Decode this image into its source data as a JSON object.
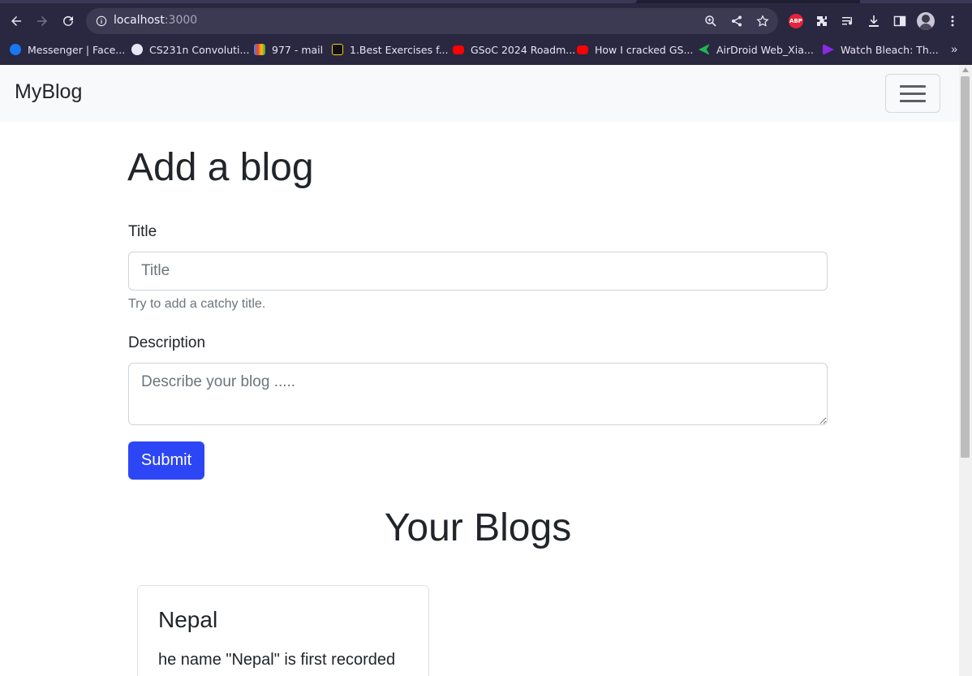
{
  "browser": {
    "url_host": "localhost",
    "url_port": ":3000",
    "bookmarks": [
      {
        "label": "Messenger | Face...",
        "icon": "facebook-icon",
        "color": "#1877f2"
      },
      {
        "label": "CS231n Convoluti...",
        "icon": "globe-icon",
        "color": "#e8e6f2"
      },
      {
        "label": "977 - mail",
        "icon": "gmail-icon",
        "color": "#ea4335"
      },
      {
        "label": "1.Best Exercises f...",
        "icon": "s-icon",
        "color": "#f5d000"
      },
      {
        "label": "GSoC 2024 Roadm...",
        "icon": "youtube-icon",
        "color": "#ff0000"
      },
      {
        "label": "How I cracked GS...",
        "icon": "youtube-icon",
        "color": "#ff0000"
      },
      {
        "label": "AirDroid Web_Xia...",
        "icon": "airdroid-icon",
        "color": "#1db954"
      },
      {
        "label": "Watch Bleach: Th...",
        "icon": "play-icon",
        "color": "#8a2be2"
      }
    ],
    "more": "»"
  },
  "navbar": {
    "brand": "MyBlog"
  },
  "form": {
    "heading": "Add a blog",
    "title_label": "Title",
    "title_placeholder": "Title",
    "title_value": "",
    "title_help": "Try to add a catchy title.",
    "description_label": "Description",
    "description_placeholder": "Describe your blog .....",
    "description_value": "",
    "submit_label": "Submit"
  },
  "blogs": {
    "heading": "Your Blogs",
    "items": [
      {
        "title": "Nepal",
        "excerpt": "he name \"Nepal\" is first recorded"
      }
    ]
  },
  "colors": {
    "primary": "#2d46f5",
    "navbar_bg": "#f8f9fa",
    "chrome_bg": "#2a2740"
  }
}
